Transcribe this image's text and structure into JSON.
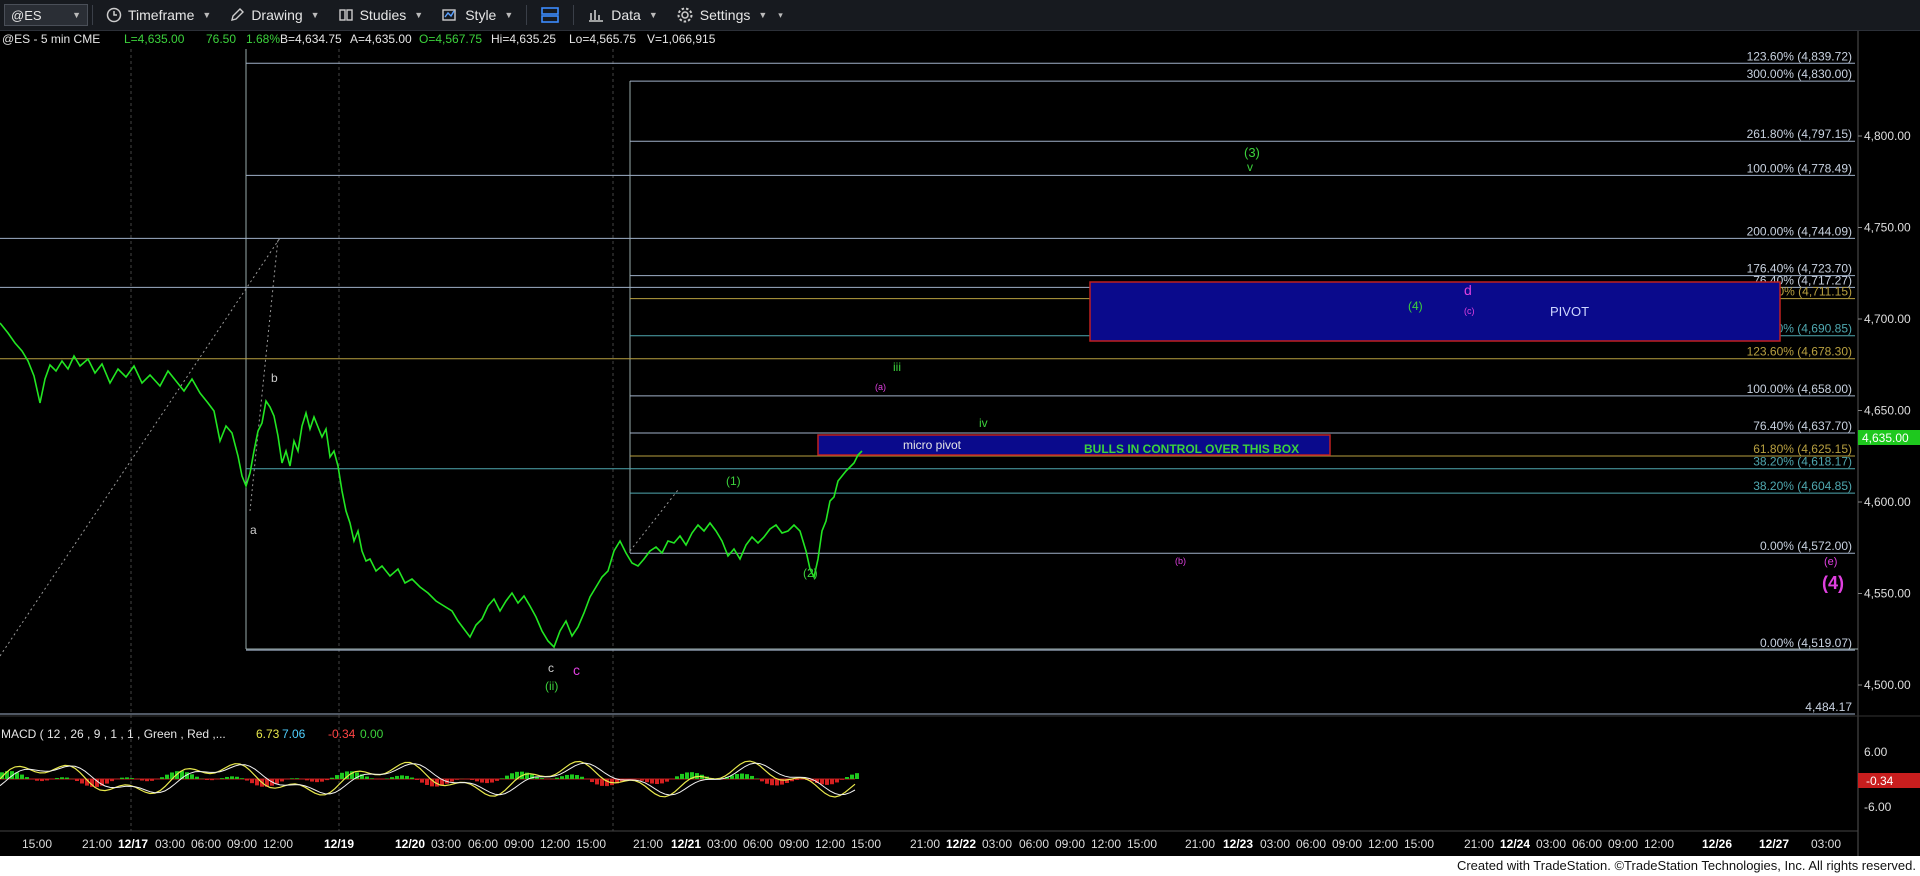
{
  "toolbar": {
    "symbol": "@ES",
    "timeframe": "Timeframe",
    "drawing": "Drawing",
    "studies": "Studies",
    "style": "Style",
    "data": "Data",
    "settings": "Settings"
  },
  "header": {
    "symbol_info": "@ES - 5 min  CME",
    "last": "L=4,635.00",
    "change": "76.50",
    "change_pct": "1.68%",
    "bid": "B=4,634.75",
    "ask": "A=4,635.00",
    "open": "O=4,567.75",
    "high": "Hi=4,635.25",
    "low": "Lo=4,565.75",
    "volume": "V=1,066,915"
  },
  "chart_data": {
    "type": "line",
    "y_axis_labels": [
      "4,800.00",
      "4,750.00",
      "4,700.00",
      "4,650.00",
      "4,600.00",
      "4,550.00",
      "4,500.00"
    ],
    "y_axis_values": [
      4800,
      4750,
      4700,
      4650,
      4600,
      4550,
      4500
    ],
    "ylim": [
      4480,
      4850
    ],
    "last_price_label": "4,635.00",
    "x_axis_labels": [
      "15:00",
      "21:00",
      "12/17",
      "03:00",
      "06:00",
      "09:00",
      "12:00",
      "12/19",
      "12/20",
      "03:00",
      "06:00",
      "09:00",
      "12:00",
      "15:00",
      "21:00",
      "12/21",
      "03:00",
      "06:00",
      "09:00",
      "12:00",
      "15:00",
      "21:00",
      "12/22",
      "03:00",
      "06:00",
      "09:00",
      "12:00",
      "15:00",
      "21:00",
      "12/23",
      "03:00",
      "06:00",
      "09:00",
      "12:00",
      "15:00",
      "21:00",
      "12/24",
      "03:00",
      "06:00",
      "09:00",
      "12:00",
      "12/26",
      "12/27",
      "03:00"
    ],
    "x_axis_bold": [
      "12/17",
      "12/19",
      "12/20",
      "12/21",
      "12/22",
      "12/23",
      "12/24",
      "12/26",
      "12/27"
    ],
    "fib_levels": [
      {
        "label": "123.60% (4,839.72)",
        "value": 4839.72
      },
      {
        "label": "300.00% (4,830.00)",
        "value": 4830.0
      },
      {
        "label": "261.80% (4,797.15)",
        "value": 4797.15
      },
      {
        "label": "100.00% (4,778.49)",
        "value": 4778.49
      },
      {
        "label": "200.00% (4,744.09)",
        "value": 4744.09
      },
      {
        "label": "176.40% (4,723.70)",
        "value": 4723.7
      },
      {
        "label": "76.40% (4,717.27)",
        "value": 4717.27
      },
      {
        "label": "161.80% (4,711.15)",
        "value": 4711.15
      },
      {
        "label": "138.20% (4,690.85)",
        "value": 4690.85
      },
      {
        "label": "123.60% (4,678.30)",
        "value": 4678.3
      },
      {
        "label": "100.00% (4,658.00)",
        "value": 4658.0
      },
      {
        "label": "76.40% (4,637.70)",
        "value": 4637.7
      },
      {
        "label": "61.80% (4,625.15)",
        "value": 4625.15
      },
      {
        "label": "38.20% (4,618.17)",
        "value": 4618.17
      },
      {
        "label": "38.20% (4,604.85)",
        "value": 4604.85
      },
      {
        "label": "0.00% (4,572.00)",
        "value": 4572.0
      },
      {
        "label": "0.00% (4,519.07)",
        "value": 4519.07
      },
      {
        "label": "4,484.17",
        "value": 4484.17
      }
    ],
    "wave_labels": [
      {
        "text": "b",
        "color": "#cccccc"
      },
      {
        "text": "a",
        "color": "#cccccc"
      },
      {
        "text": "c",
        "color": "#cccccc"
      },
      {
        "text": "c",
        "color": "#e040e0"
      },
      {
        "text": "(ii)",
        "color": "#3cd23c"
      },
      {
        "text": "(1)",
        "color": "#3cd23c"
      },
      {
        "text": "(2)",
        "color": "#3cd23c"
      },
      {
        "text": "iii",
        "color": "#3cd23c"
      },
      {
        "text": "(a)",
        "color": "#e040e0"
      },
      {
        "text": "iv",
        "color": "#3cd23c"
      },
      {
        "text": "(3)",
        "color": "#3cd23c"
      },
      {
        "text": "v",
        "color": "#3cd23c"
      },
      {
        "text": "(4)",
        "color": "#3cd23c"
      },
      {
        "text": "d",
        "color": "#e040e0"
      },
      {
        "text": "(c)",
        "color": "#e040e0"
      },
      {
        "text": "(b)",
        "color": "#e040e0"
      },
      {
        "text": "(e)",
        "color": "#e040e0"
      },
      {
        "text": "(4)",
        "color": "#e040e0"
      }
    ],
    "boxes": [
      {
        "label": "PIVOT",
        "top": 4720,
        "bottom": 4680
      },
      {
        "label": "micro pivot",
        "top": 4637,
        "bottom": 4625
      },
      {
        "label": "BULLS IN CONTROL OVER THIS BOX",
        "top": 4637,
        "bottom": 4625
      }
    ],
    "macd": {
      "title": "MACD ( 12 , 26 , 9 , 1 , 1 , Green , Red ,...",
      "macd_value": "6.73",
      "signal_value": "7.06",
      "diff_value": "-0.34",
      "zero_value": "0.00",
      "axis_labels": [
        "6.00",
        "-6.00"
      ],
      "last_label": "-0.34"
    }
  },
  "footer": "Created with TradeStation. ©TradeStation Technologies, Inc. All rights reserved."
}
